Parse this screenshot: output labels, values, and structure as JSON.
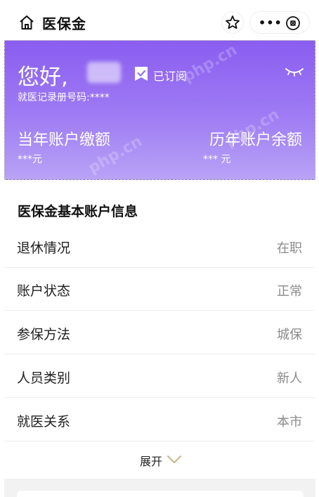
{
  "header": {
    "title": "医保金",
    "more_label": "•••"
  },
  "account": {
    "greeting": "您好,",
    "subscribe_label": "已订阅",
    "record_no": "就医记录册号码:****",
    "current_year_title": "当年账户缴额",
    "current_year_value": "***元",
    "history_title": "历年账户余额",
    "history_value": "*** 元",
    "watermark": "php.cn",
    "gradient_top": "#8a5df0",
    "gradient_bottom": "#b8a3f5"
  },
  "info": {
    "title": "医保金基本账户信息",
    "rows": [
      {
        "label": "退休情况",
        "value": "在职"
      },
      {
        "label": "账户状态",
        "value": "正常"
      },
      {
        "label": "参保方法",
        "value": "城保"
      },
      {
        "label": "人员类别",
        "value": "新人"
      },
      {
        "label": "就医关系",
        "value": "本市"
      }
    ],
    "expand_label": "展开",
    "value_color": "#8a8a8a",
    "accent_color": "#c9b38a"
  }
}
